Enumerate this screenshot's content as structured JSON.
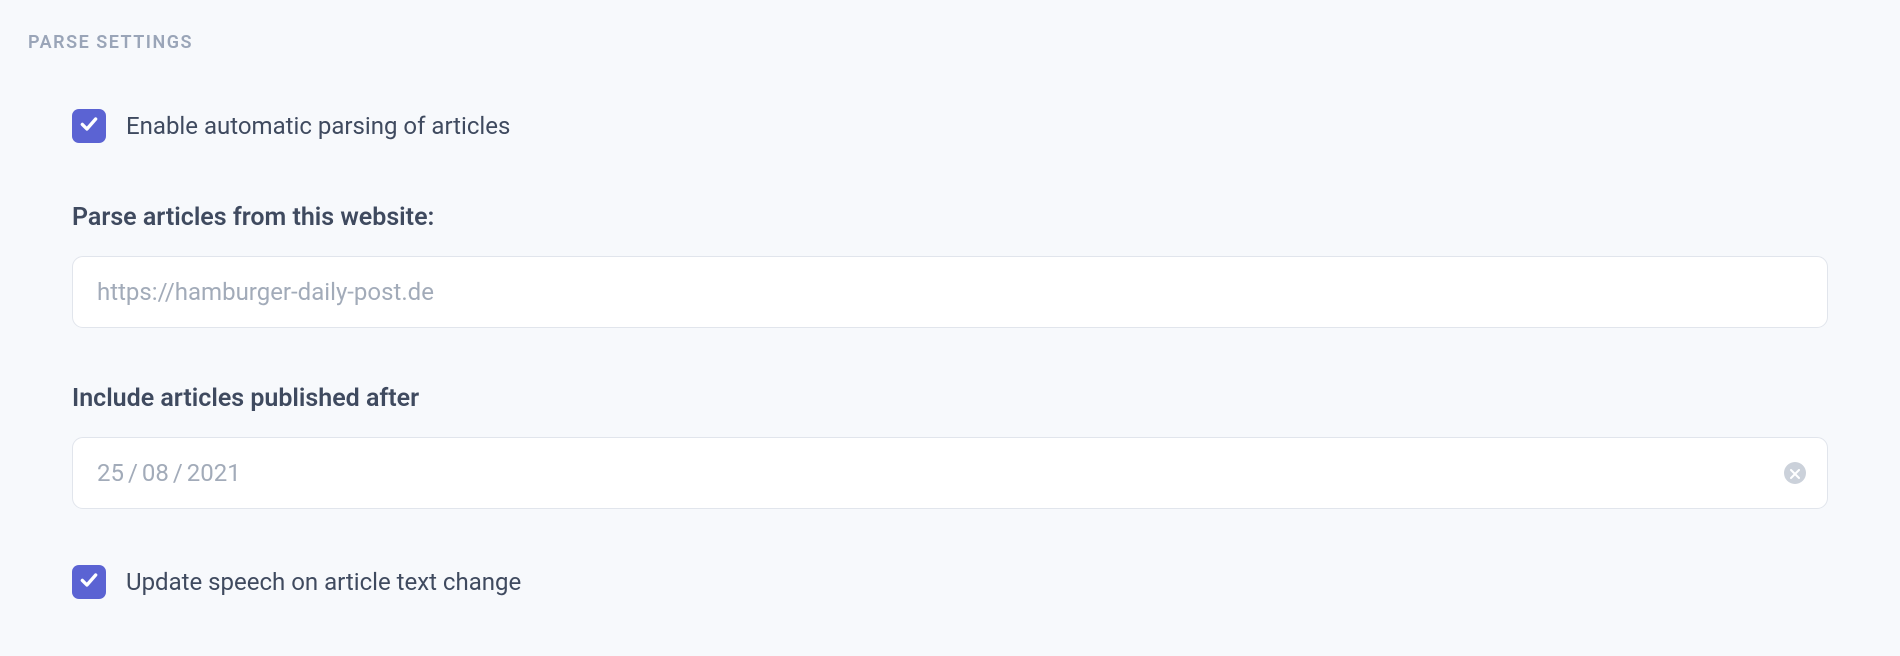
{
  "section": {
    "title": "PARSE SETTINGS"
  },
  "enable_parsing": {
    "checked": true,
    "label": "Enable automatic parsing of articles"
  },
  "website": {
    "label": "Parse articles from this website:",
    "placeholder": "https://hamburger-daily-post.de",
    "value": ""
  },
  "published_after": {
    "label": "Include articles published after",
    "day": "25",
    "month": "08",
    "year": "2021"
  },
  "update_speech": {
    "checked": true,
    "label": "Update speech on article text change"
  }
}
